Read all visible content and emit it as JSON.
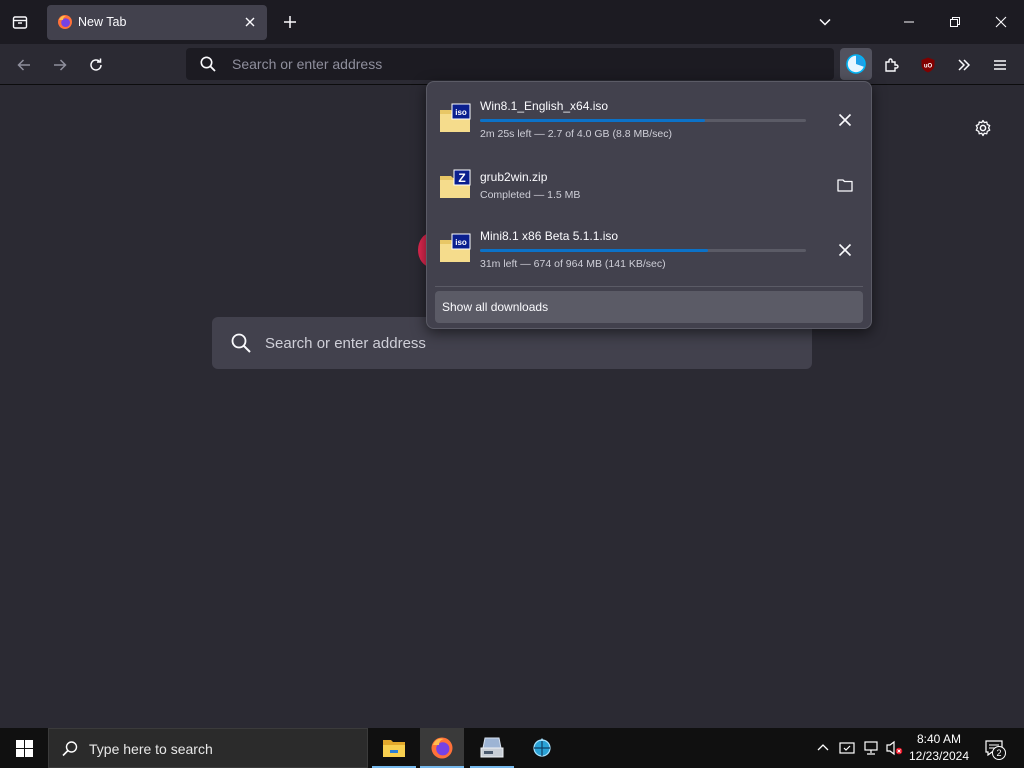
{
  "tab": {
    "title": "New Tab"
  },
  "urlbar": {
    "placeholder": "Search or enter address"
  },
  "newtab": {
    "search_placeholder": "Search or enter address"
  },
  "downloads": {
    "items": [
      {
        "name": "Win8.1_English_x64.iso",
        "status": "2m 25s left — 2.7 of 4.0 GB (8.8 MB/sec)",
        "progress": 0.69,
        "badge": "iso",
        "action": "cancel"
      },
      {
        "name": "grub2win.zip",
        "status": "Completed — 1.5 MB",
        "progress": null,
        "badge": "Z",
        "action": "show-in-folder"
      },
      {
        "name": "Mini8.1 x86 Beta 5.1.1.iso",
        "status": "31m left — 674 of 964 MB (141 KB/sec)",
        "progress": 0.7,
        "badge": "iso",
        "action": "cancel"
      }
    ],
    "show_all_label": "Show all downloads"
  },
  "taskbar": {
    "search_text": "Type here to search",
    "time": "8:40 AM",
    "date": "12/23/2024",
    "notification_count": "2"
  },
  "colors": {
    "accent": "#0b72c8",
    "toolbar": "#2b2a33",
    "panel": "#42414d"
  }
}
